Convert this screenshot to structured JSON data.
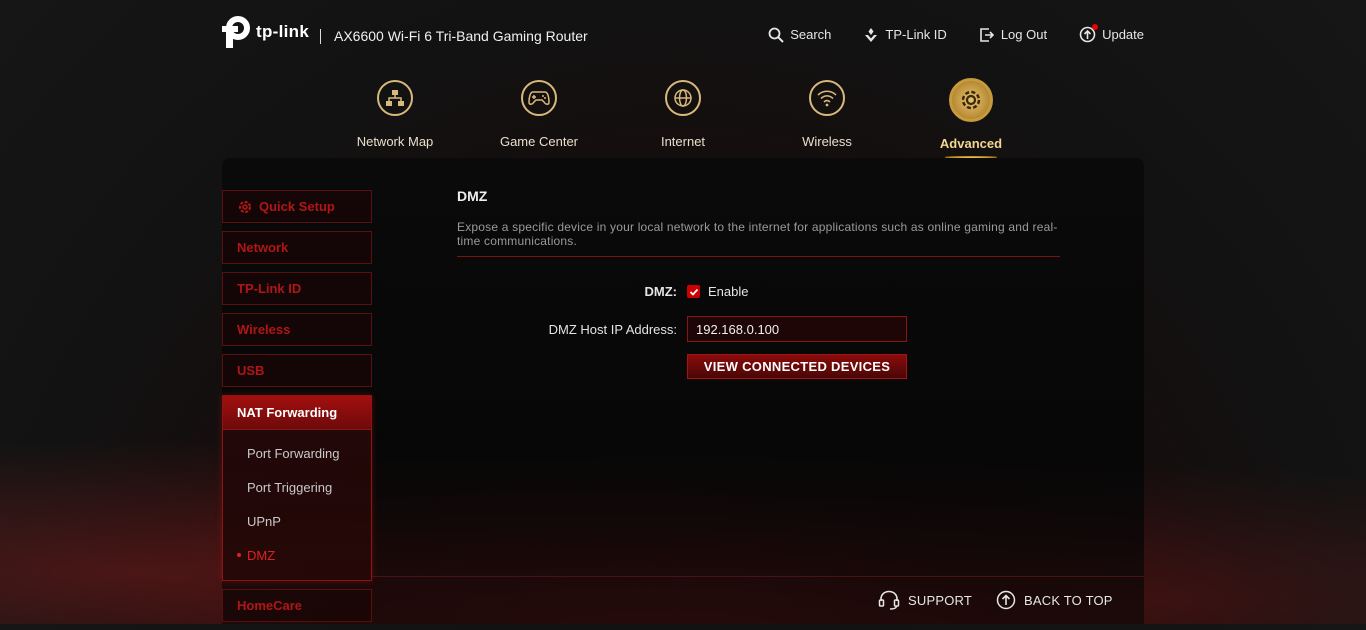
{
  "header": {
    "brand": "tp-link",
    "model": "AX6600 Wi-Fi 6 Tri-Band Gaming Router",
    "links": [
      {
        "label": "Search",
        "icon": "search-icon"
      },
      {
        "label": "TP-Link ID",
        "icon": "tplink-id-icon"
      },
      {
        "label": "Log Out",
        "icon": "logout-icon"
      },
      {
        "label": "Update",
        "icon": "update-icon"
      }
    ]
  },
  "mainnav": [
    {
      "label": "Network Map",
      "icon": "network-map-icon"
    },
    {
      "label": "Game Center",
      "icon": "gamepad-icon"
    },
    {
      "label": "Internet",
      "icon": "globe-icon"
    },
    {
      "label": "Wireless",
      "icon": "wifi-icon"
    },
    {
      "label": "Advanced",
      "icon": "gear-icon",
      "active": true
    }
  ],
  "sidebar": {
    "items": [
      {
        "label": "Quick Setup"
      },
      {
        "label": "Network"
      },
      {
        "label": "TP-Link ID"
      },
      {
        "label": "Wireless"
      },
      {
        "label": "USB"
      },
      {
        "label": "NAT Forwarding",
        "active": true
      },
      {
        "label": "HomeCare"
      }
    ],
    "nat_sub": [
      {
        "label": "Port Forwarding"
      },
      {
        "label": "Port Triggering"
      },
      {
        "label": "UPnP"
      },
      {
        "label": "DMZ",
        "active": true
      }
    ]
  },
  "content": {
    "title": "DMZ",
    "description": "Expose a specific device in your local network to the internet for applications such as online gaming and real-time communications.",
    "dmz_label": "DMZ:",
    "enable_label": "Enable",
    "enabled": true,
    "host_label": "DMZ Host IP Address:",
    "host_ip": "192.168.0.100",
    "view_button": "VIEW CONNECTED DEVICES"
  },
  "footer": {
    "support": "SUPPORT",
    "back_to_top": "BACK TO TOP"
  },
  "colors": {
    "accent_red": "#c00000",
    "gold": "#d8b97a"
  }
}
